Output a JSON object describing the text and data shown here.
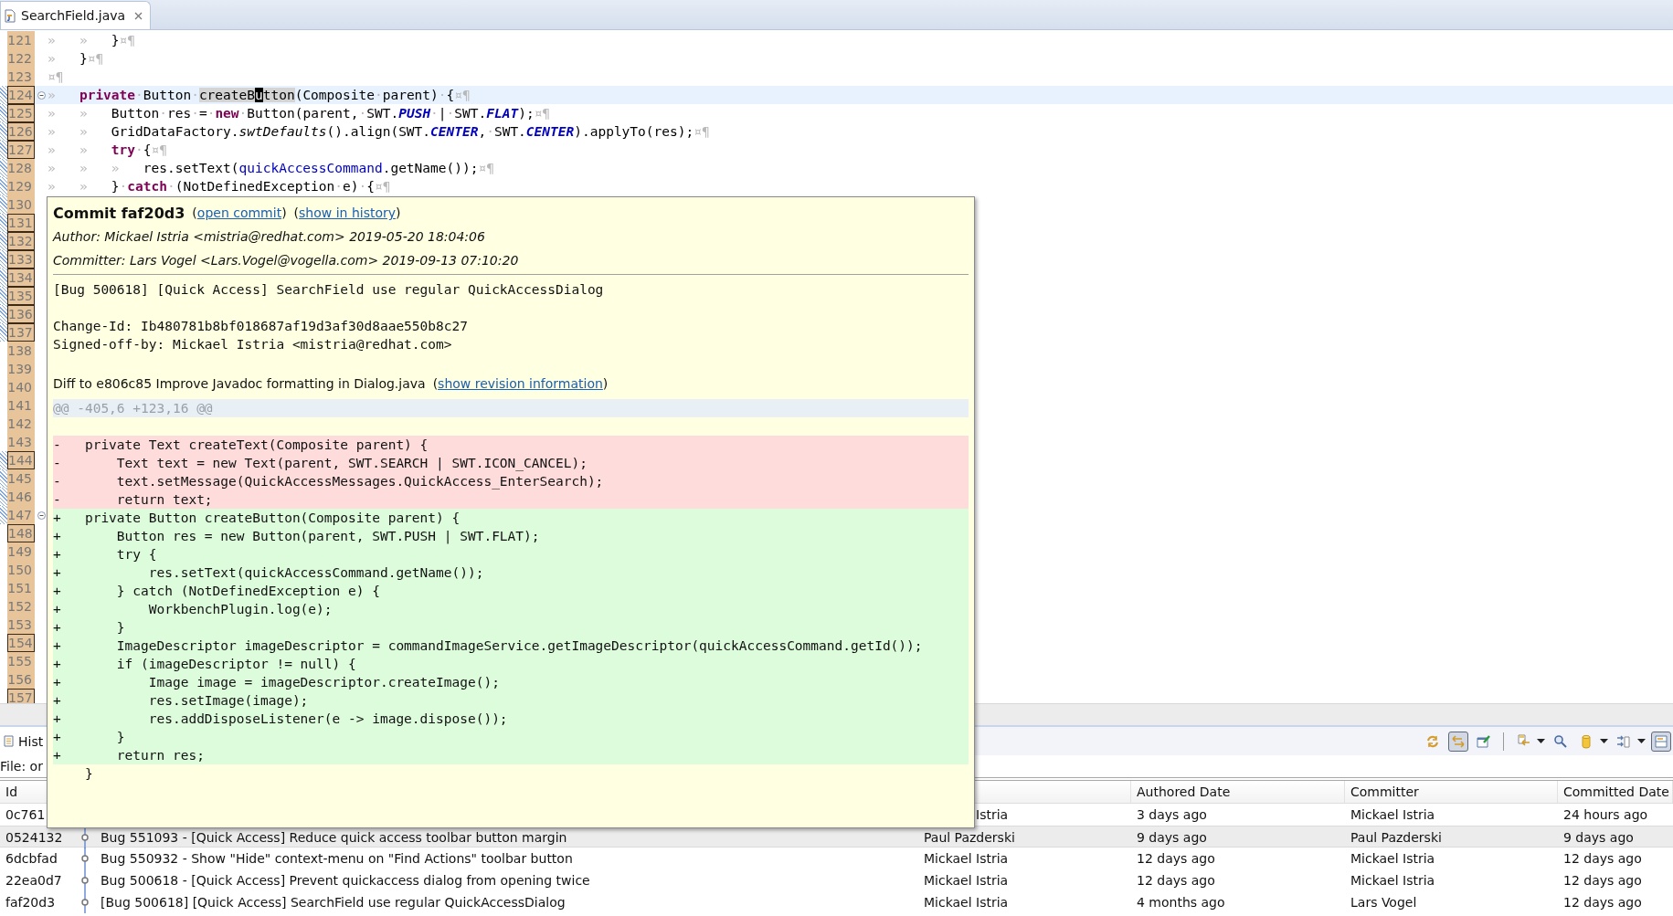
{
  "editor_tab": {
    "label": "SearchField.java",
    "selected": true
  },
  "editor_lines": [
    {
      "number": "121",
      "boxed": false,
      "marked": false,
      "foldable": false,
      "current": false,
      "tokens": [
        {
          "kind": "ws",
          "text": "»   »   "
        },
        {
          "kind": "plain",
          "text": "}"
        },
        {
          "kind": "ws",
          "text": "¤¶"
        }
      ]
    },
    {
      "number": "122",
      "boxed": false,
      "marked": false,
      "foldable": false,
      "current": false,
      "tokens": [
        {
          "kind": "ws",
          "text": "»   "
        },
        {
          "kind": "plain",
          "text": "}"
        },
        {
          "kind": "ws",
          "text": "¤¶"
        }
      ]
    },
    {
      "number": "123",
      "boxed": false,
      "marked": false,
      "foldable": false,
      "current": false,
      "tokens": [
        {
          "kind": "ws",
          "text": "¤¶"
        }
      ]
    },
    {
      "number": "124",
      "boxed": true,
      "marked": true,
      "foldable": true,
      "current": true,
      "tokens": [
        {
          "kind": "ws",
          "text": "»   "
        },
        {
          "kind": "kw",
          "text": "private"
        },
        {
          "kind": "ws",
          "text": "·"
        },
        {
          "kind": "plain",
          "text": "Button"
        },
        {
          "kind": "ws",
          "text": "·"
        },
        {
          "kind": "sel",
          "text": "createB"
        },
        {
          "kind": "cursor",
          "text": "u"
        },
        {
          "kind": "sel",
          "text": "tton"
        },
        {
          "kind": "plain",
          "text": "(Composite"
        },
        {
          "kind": "ws",
          "text": "·"
        },
        {
          "kind": "plain",
          "text": "parent)"
        },
        {
          "kind": "ws",
          "text": "·"
        },
        {
          "kind": "plain",
          "text": "{"
        },
        {
          "kind": "ws",
          "text": "¤¶"
        }
      ]
    },
    {
      "number": "125",
      "boxed": true,
      "marked": true,
      "foldable": false,
      "current": false,
      "tokens": [
        {
          "kind": "ws",
          "text": "»   »   "
        },
        {
          "kind": "plain",
          "text": "Button"
        },
        {
          "kind": "ws",
          "text": "·"
        },
        {
          "kind": "plain",
          "text": "res"
        },
        {
          "kind": "ws",
          "text": "·"
        },
        {
          "kind": "plain",
          "text": "="
        },
        {
          "kind": "ws",
          "text": "·"
        },
        {
          "kind": "kw",
          "text": "new"
        },
        {
          "kind": "ws",
          "text": "·"
        },
        {
          "kind": "plain",
          "text": "Button(parent,"
        },
        {
          "kind": "ws",
          "text": "·"
        },
        {
          "kind": "plain",
          "text": "SWT."
        },
        {
          "kind": "const",
          "text": "PUSH"
        },
        {
          "kind": "ws",
          "text": "·"
        },
        {
          "kind": "plain",
          "text": "|"
        },
        {
          "kind": "ws",
          "text": "·"
        },
        {
          "kind": "plain",
          "text": "SWT."
        },
        {
          "kind": "const",
          "text": "FLAT"
        },
        {
          "kind": "plain",
          "text": ");"
        },
        {
          "kind": "ws",
          "text": "¤¶"
        }
      ]
    },
    {
      "number": "126",
      "boxed": true,
      "marked": true,
      "foldable": false,
      "current": false,
      "tokens": [
        {
          "kind": "ws",
          "text": "»   »   "
        },
        {
          "kind": "plain",
          "text": "GridDataFactory."
        },
        {
          "kind": "static",
          "text": "swtDefaults"
        },
        {
          "kind": "plain",
          "text": "().align(SWT."
        },
        {
          "kind": "const",
          "text": "CENTER"
        },
        {
          "kind": "plain",
          "text": ","
        },
        {
          "kind": "ws",
          "text": "·"
        },
        {
          "kind": "plain",
          "text": "SWT."
        },
        {
          "kind": "const",
          "text": "CENTER"
        },
        {
          "kind": "plain",
          "text": ").applyTo(res);"
        },
        {
          "kind": "ws",
          "text": "¤¶"
        }
      ]
    },
    {
      "number": "127",
      "boxed": true,
      "marked": true,
      "foldable": false,
      "current": false,
      "tokens": [
        {
          "kind": "ws",
          "text": "»   »   "
        },
        {
          "kind": "kw",
          "text": "try"
        },
        {
          "kind": "ws",
          "text": "·"
        },
        {
          "kind": "plain",
          "text": "{"
        },
        {
          "kind": "ws",
          "text": "¤¶"
        }
      ]
    },
    {
      "number": "128",
      "boxed": false,
      "marked": true,
      "foldable": false,
      "current": false,
      "tokens": [
        {
          "kind": "ws",
          "text": "»   »   »   "
        },
        {
          "kind": "plain",
          "text": "res.setText("
        },
        {
          "kind": "field",
          "text": "quickAccessCommand"
        },
        {
          "kind": "plain",
          "text": ".getName());"
        },
        {
          "kind": "ws",
          "text": "¤¶"
        }
      ]
    },
    {
      "number": "129",
      "boxed": false,
      "marked": true,
      "foldable": false,
      "current": false,
      "tokens": [
        {
          "kind": "ws",
          "text": "»   »   "
        },
        {
          "kind": "plain",
          "text": "}"
        },
        {
          "kind": "ws",
          "text": "·"
        },
        {
          "kind": "kw",
          "text": "catch"
        },
        {
          "kind": "ws",
          "text": "·"
        },
        {
          "kind": "plain",
          "text": "(NotDefinedException"
        },
        {
          "kind": "ws",
          "text": "·"
        },
        {
          "kind": "plain",
          "text": "e)"
        },
        {
          "kind": "ws",
          "text": "·"
        },
        {
          "kind": "plain",
          "text": "{"
        },
        {
          "kind": "ws",
          "text": "¤¶"
        }
      ]
    },
    {
      "number": "130",
      "boxed": false,
      "marked": true,
      "foldable": false,
      "current": false
    },
    {
      "number": "131",
      "boxed": true,
      "marked": true,
      "foldable": false,
      "current": false
    },
    {
      "number": "132",
      "boxed": true,
      "marked": true,
      "foldable": false,
      "current": false
    },
    {
      "number": "133",
      "boxed": true,
      "marked": true,
      "foldable": false,
      "current": false
    },
    {
      "number": "134",
      "boxed": true,
      "marked": true,
      "foldable": false,
      "current": false
    },
    {
      "number": "135",
      "boxed": true,
      "marked": true,
      "foldable": false,
      "current": false
    },
    {
      "number": "136",
      "boxed": true,
      "marked": true,
      "foldable": false,
      "current": false
    },
    {
      "number": "137",
      "boxed": true,
      "marked": true,
      "foldable": false,
      "current": false
    },
    {
      "number": "138",
      "boxed": false,
      "marked": false,
      "foldable": false,
      "current": false
    },
    {
      "number": "139",
      "boxed": false,
      "marked": false,
      "foldable": false,
      "current": false
    },
    {
      "number": "140",
      "boxed": false,
      "marked": false,
      "foldable": false,
      "current": false
    },
    {
      "number": "141",
      "boxed": false,
      "marked": false,
      "foldable": false,
      "current": false
    },
    {
      "number": "142",
      "boxed": false,
      "marked": false,
      "foldable": false,
      "current": false
    },
    {
      "number": "143",
      "boxed": false,
      "marked": false,
      "foldable": false,
      "current": false
    },
    {
      "number": "144",
      "boxed": true,
      "marked": true,
      "foldable": false,
      "current": false
    },
    {
      "number": "145",
      "boxed": false,
      "marked": true,
      "foldable": false,
      "current": false
    },
    {
      "number": "146",
      "boxed": false,
      "marked": true,
      "foldable": false,
      "current": false
    },
    {
      "number": "147",
      "boxed": false,
      "marked": true,
      "foldable": true,
      "current": false
    },
    {
      "number": "148",
      "boxed": true,
      "marked": false,
      "foldable": false,
      "current": false
    },
    {
      "number": "149",
      "boxed": false,
      "marked": false,
      "foldable": false,
      "current": false
    },
    {
      "number": "150",
      "boxed": false,
      "marked": false,
      "foldable": false,
      "current": false
    },
    {
      "number": "151",
      "boxed": false,
      "marked": false,
      "foldable": false,
      "current": false
    },
    {
      "number": "152",
      "boxed": false,
      "marked": false,
      "foldable": false,
      "current": false
    },
    {
      "number": "153",
      "boxed": false,
      "marked": false,
      "foldable": false,
      "current": false
    },
    {
      "number": "154",
      "boxed": true,
      "marked": false,
      "foldable": false,
      "current": false
    },
    {
      "number": "155",
      "boxed": false,
      "marked": false,
      "foldable": false,
      "current": false
    },
    {
      "number": "156",
      "boxed": false,
      "marked": false,
      "foldable": false,
      "current": false
    },
    {
      "number": "157",
      "boxed": true,
      "marked": false,
      "foldable": false,
      "current": false
    }
  ],
  "history_view": {
    "tab": {
      "label": "Hist",
      "selected": true
    },
    "file_label": "File: or",
    "toolbar": [
      {
        "kind": "sync",
        "pressed": false,
        "dropdown": false
      },
      {
        "kind": "link",
        "pressed": true,
        "dropdown": false
      },
      {
        "kind": "pin",
        "pressed": false,
        "dropdown": false
      },
      {
        "kind": "separator"
      },
      {
        "kind": "compare",
        "pressed": false,
        "dropdown": true
      },
      {
        "kind": "search",
        "pressed": false,
        "dropdown": false
      },
      {
        "kind": "repository",
        "pressed": false,
        "dropdown": true
      },
      {
        "kind": "filter",
        "pressed": false,
        "dropdown": true
      },
      {
        "kind": "layout",
        "pressed": true,
        "dropdown": false
      }
    ],
    "columns": [
      "Id",
      "Authored Date",
      "Committer",
      "Committed Date"
    ],
    "rows": [
      {
        "id": "0c761",
        "covered": true,
        "selected": false,
        "author": "Istria",
        "authored": "3 days ago",
        "committer": "Mickael Istria",
        "committed": "24 hours ago"
      },
      {
        "id": "0524132",
        "covered": false,
        "selected": true,
        "message": "Bug 551093 - [Quick Access] Reduce quick access toolbar button margin",
        "author": "Paul Pazderski",
        "authored": "9 days ago",
        "committer": "Paul Pazderski",
        "committed": "9 days ago"
      },
      {
        "id": "6dcbfad",
        "covered": false,
        "selected": false,
        "message": "Bug 550932 - Show \"Hide\" context-menu on \"Find Actions\" toolbar button",
        "author": "Mickael Istria",
        "authored": "12 days ago",
        "committer": "Mickael Istria",
        "committed": "12 days ago"
      },
      {
        "id": "22ea0d7",
        "covered": false,
        "selected": false,
        "message": "Bug 500618 - [Quick Access] Prevent quickaccess dialog from opening twice",
        "author": "Mickael Istria",
        "authored": "12 days ago",
        "committer": "Mickael Istria",
        "committed": "12 days ago"
      },
      {
        "id": "faf20d3",
        "covered": false,
        "selected": false,
        "message": "[Bug 500618] [Quick Access] SearchField use regular QuickAccessDialog",
        "author": "Mickael Istria",
        "authored": "4 months ago",
        "committer": "Lars Vogel",
        "committed": "12 days ago"
      }
    ]
  },
  "commit_popup": {
    "title": "Commit faf20d3",
    "links": [
      {
        "before": "(",
        "label": "open commit",
        "after": ")"
      },
      {
        "before": "(",
        "label": "show in history",
        "after": ")"
      }
    ],
    "author": "Author: Mickael Istria <mistria@redhat.com> 2019-05-20 18:04:06",
    "committer": "Committer: Lars Vogel <Lars.Vogel@vogella.com> 2019-09-13 07:10:20",
    "message_paragraphs": [
      [
        "[Bug 500618] [Quick Access] SearchField use regular QuickAccessDialog"
      ],
      [
        "Change-Id: Ib480781b8bf018687af19d3af30d8aae550b8c27",
        "Signed-off-by: Mickael Istria <mistria@redhat.com>"
      ]
    ],
    "diff_to": "Diff to e806c85 Improve Javadoc formatting in Dialog.java",
    "diff_link": {
      "before": "(",
      "label": "show revision information",
      "after": ")"
    },
    "hunk_header": "@@ -405,6 +123,16 @@",
    "diff_lines": [
      {
        "kind": "removed",
        "text": "-   private Text createText(Composite parent) {"
      },
      {
        "kind": "removed",
        "text": "-       Text text = new Text(parent, SWT.SEARCH | SWT.ICON_CANCEL);"
      },
      {
        "kind": "removed",
        "text": "-       text.setMessage(QuickAccessMessages.QuickAccess_EnterSearch);"
      },
      {
        "kind": "removed",
        "text": "-       return text;"
      },
      {
        "kind": "added",
        "text": "+   private Button createButton(Composite parent) {"
      },
      {
        "kind": "added",
        "text": "+       Button res = new Button(parent, SWT.PUSH | SWT.FLAT);"
      },
      {
        "kind": "added",
        "text": "+       try {"
      },
      {
        "kind": "added",
        "text": "+           res.setText(quickAccessCommand.getName());"
      },
      {
        "kind": "added",
        "text": "+       } catch (NotDefinedException e) {"
      },
      {
        "kind": "added",
        "text": "+           WorkbenchPlugin.log(e);"
      },
      {
        "kind": "added",
        "text": "+       }"
      },
      {
        "kind": "added",
        "text": "+       ImageDescriptor imageDescriptor = commandImageService.getImageDescriptor(quickAccessCommand.getId());"
      },
      {
        "kind": "added",
        "text": "+       if (imageDescriptor != null) {"
      },
      {
        "kind": "added",
        "text": "+           Image image = imageDescriptor.createImage();"
      },
      {
        "kind": "added",
        "text": "+           res.setImage(image);"
      },
      {
        "kind": "added",
        "text": "+           res.addDisposeListener(e -> image.dispose());"
      },
      {
        "kind": "added",
        "text": "+       }"
      },
      {
        "kind": "added",
        "text": "+       return res;"
      },
      {
        "kind": "context",
        "text": "    }"
      }
    ]
  }
}
